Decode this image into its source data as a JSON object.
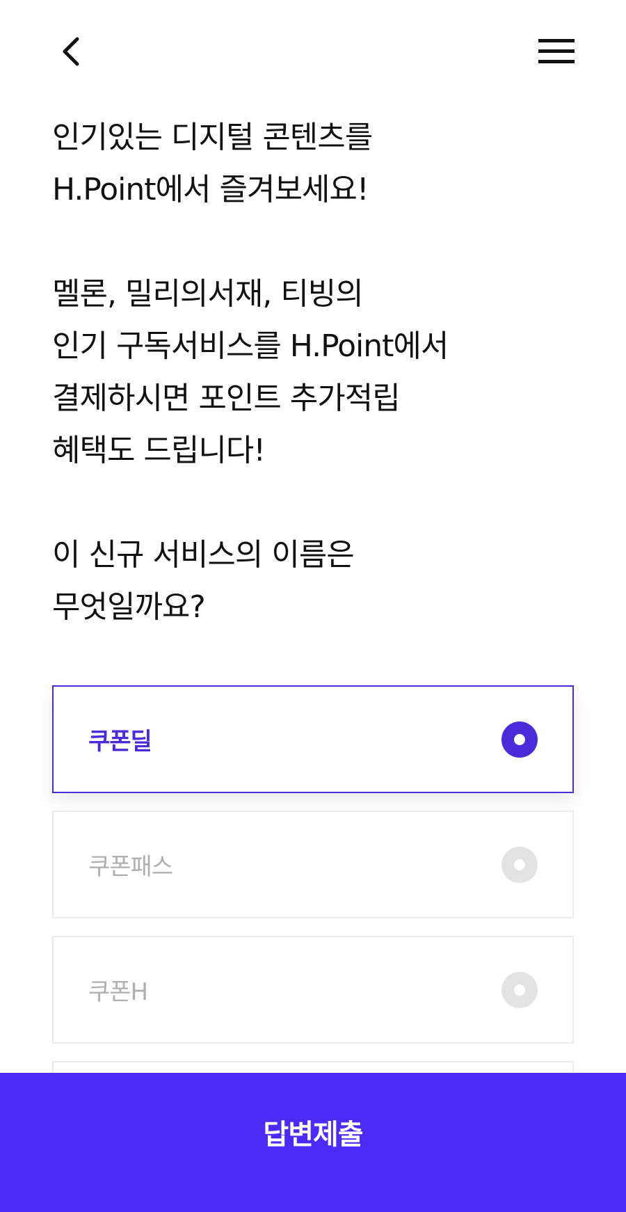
{
  "header": {
    "back_icon": "chevron-left-icon",
    "menu_icon": "hamburger-menu-icon"
  },
  "content": {
    "intro": "인기있는 디지털 콘텐츠를\nH.Point에서 즐겨보세요!",
    "description": "멜론, 밀리의서재, 티빙의\n인기 구독서비스를 H.Point에서\n결제하시면 포인트 추가적립\n혜택도 드립니다!",
    "question": "이 신규 서비스의 이름은\n무엇일까요?"
  },
  "options": [
    {
      "label": "쿠폰딜",
      "selected": true
    },
    {
      "label": "쿠폰패스",
      "selected": false
    },
    {
      "label": "쿠폰H",
      "selected": false
    }
  ],
  "submit": {
    "label": "답변제출"
  },
  "colors": {
    "accent": "#4b2bd9",
    "submit_bg": "#4b2bf5",
    "radio_inactive": "#e3e3e3",
    "text_inactive": "#b0b0b0"
  }
}
